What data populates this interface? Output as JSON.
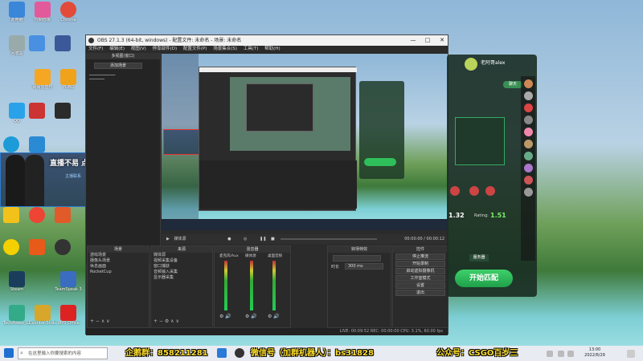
{
  "desktop": {
    "icons": [
      {
        "label": "此电脑",
        "color": "#3a86d8"
      },
      {
        "label": "回收站",
        "color": "#9aa"
      },
      {
        "label": "控制面板",
        "color": "#2f7bd0"
      },
      {
        "label": "Chrome",
        "color": "#e24a3a"
      },
      {
        "label": "网易云音乐",
        "color": "#d33"
      },
      {
        "label": "PUBG",
        "color": "#f1a21b"
      },
      {
        "label": "QQ",
        "color": "#2aa2e9"
      },
      {
        "label": "Steam",
        "color": "#1b3d5c"
      },
      {
        "label": "WPS Office",
        "color": "#d22"
      },
      {
        "label": "TeamSpeak 3",
        "color": "#3a6cc0"
      },
      {
        "label": "Counter-Strike",
        "color": "#d8a62a"
      },
      {
        "label": "TechPower GPU-Z",
        "color": "#3a8"
      }
    ]
  },
  "overlay": {
    "title": "直播不易 点点关注",
    "tag": "主播联系"
  },
  "obs": {
    "title": "OBS 27.1.3 (64-bit, windows) - 配置文件: 未命名 - 场景: 未命名",
    "menu": [
      "文件(F)",
      "编辑(E)",
      "视图(V)",
      "停靠部件(D)",
      "配置文件(P)",
      "场景集合(S)",
      "工具(T)",
      "帮助(H)"
    ],
    "left_panel": {
      "header": "多视图(窗口)",
      "note": "添加场景"
    },
    "media": {
      "source": "媒体源",
      "time": "00:00:00 / 00:00:12"
    },
    "docks": {
      "scenes": {
        "header": "场景",
        "items": [
          "游戏场景",
          "摄像头场景",
          "休息画面",
          "RocketCup"
        ]
      },
      "sources": {
        "header": "来源",
        "items": [
          "媒体源",
          "视频采集设备",
          "窗口捕获",
          "音频输入采集",
          "显示器采集"
        ]
      },
      "mixer": {
        "header": "混音器",
        "channels": [
          "麦克风/Aux",
          "媒体源",
          "桌面音频"
        ]
      },
      "transitions": {
        "header": "转场特效",
        "duration_label": "时长",
        "duration": "300 ms"
      },
      "controls": {
        "header": "控件",
        "buttons": [
          "停止推流",
          "开始录制",
          "启动虚拟摄像机",
          "工作室模式",
          "设置",
          "退出"
        ]
      }
    },
    "status": "LIVE: 00:09:52   REC: 00:00:00   CPU: 3.1%, 60.00 fps"
  },
  "game": {
    "user": "老阿哥alex",
    "tab": "聊天",
    "rating_label": "Rating:",
    "rating": "1.51",
    "score": "1.32",
    "start_button": "开始匹配",
    "mode_label": "服务器"
  },
  "taskbar": {
    "search_placeholder": "在这里输入你要搜索的内容",
    "banner_qq": "企鹅群：858211281",
    "banner_wechat": "微信号（加群机器人）：bs31828",
    "banner_official": "公众号：CSGO百岁三",
    "time": "13:00",
    "date": "2022/6/29"
  }
}
